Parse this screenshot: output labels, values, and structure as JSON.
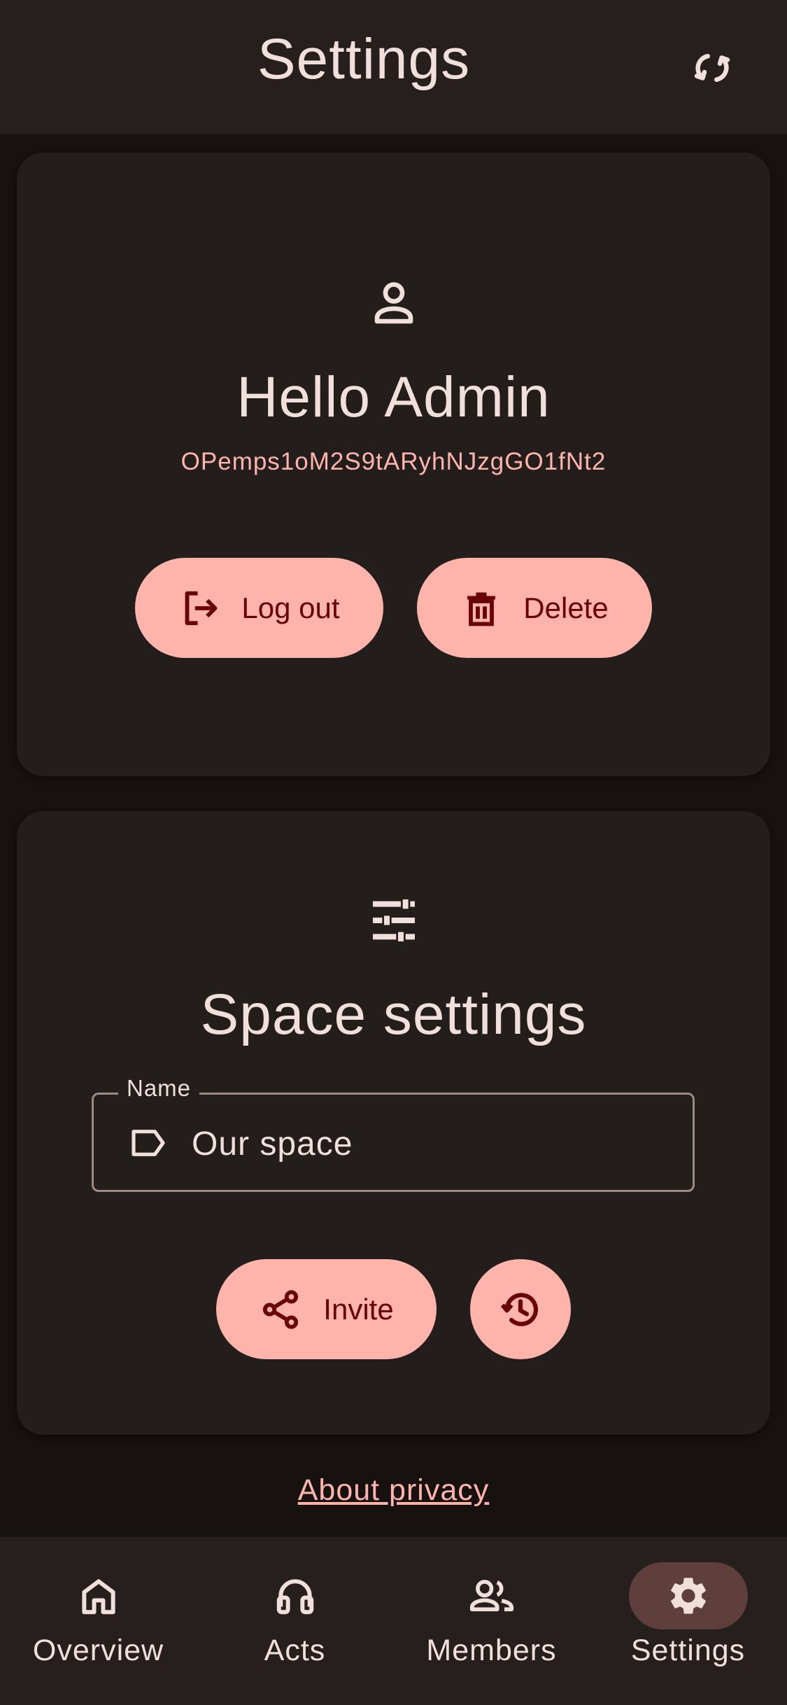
{
  "header": {
    "title": "Settings",
    "sync_icon": "sync-icon"
  },
  "account_card": {
    "icon": "person-icon",
    "greeting": "Hello Admin",
    "user_id": "OPemps1oM2S9tARyhNJzgGO1fNt2",
    "logout_label": "Log out",
    "logout_icon": "logout-icon",
    "delete_label": "Delete",
    "delete_icon": "trash-icon"
  },
  "space_card": {
    "icon": "tune-icon",
    "heading": "Space settings",
    "name_field": {
      "label": "Name",
      "value": "Our space",
      "icon": "label-icon"
    },
    "invite_label": "Invite",
    "invite_icon": "share-icon",
    "history_icon": "history-icon"
  },
  "footer": {
    "privacy_link": "About privacy"
  },
  "bottom_nav": {
    "items": [
      {
        "label": "Overview",
        "icon": "home-icon",
        "active": false
      },
      {
        "label": "Acts",
        "icon": "headphones-icon",
        "active": false
      },
      {
        "label": "Members",
        "icon": "group-icon",
        "active": false
      },
      {
        "label": "Settings",
        "icon": "gear-icon",
        "active": true
      }
    ]
  },
  "colors": {
    "background": "#171210",
    "surface": "#231d1c",
    "bar": "#261f1e",
    "accent": "#ffb4ab",
    "on_accent": "#690005",
    "text": "#f0dfdb",
    "active_indicator": "#5e3f3b"
  }
}
